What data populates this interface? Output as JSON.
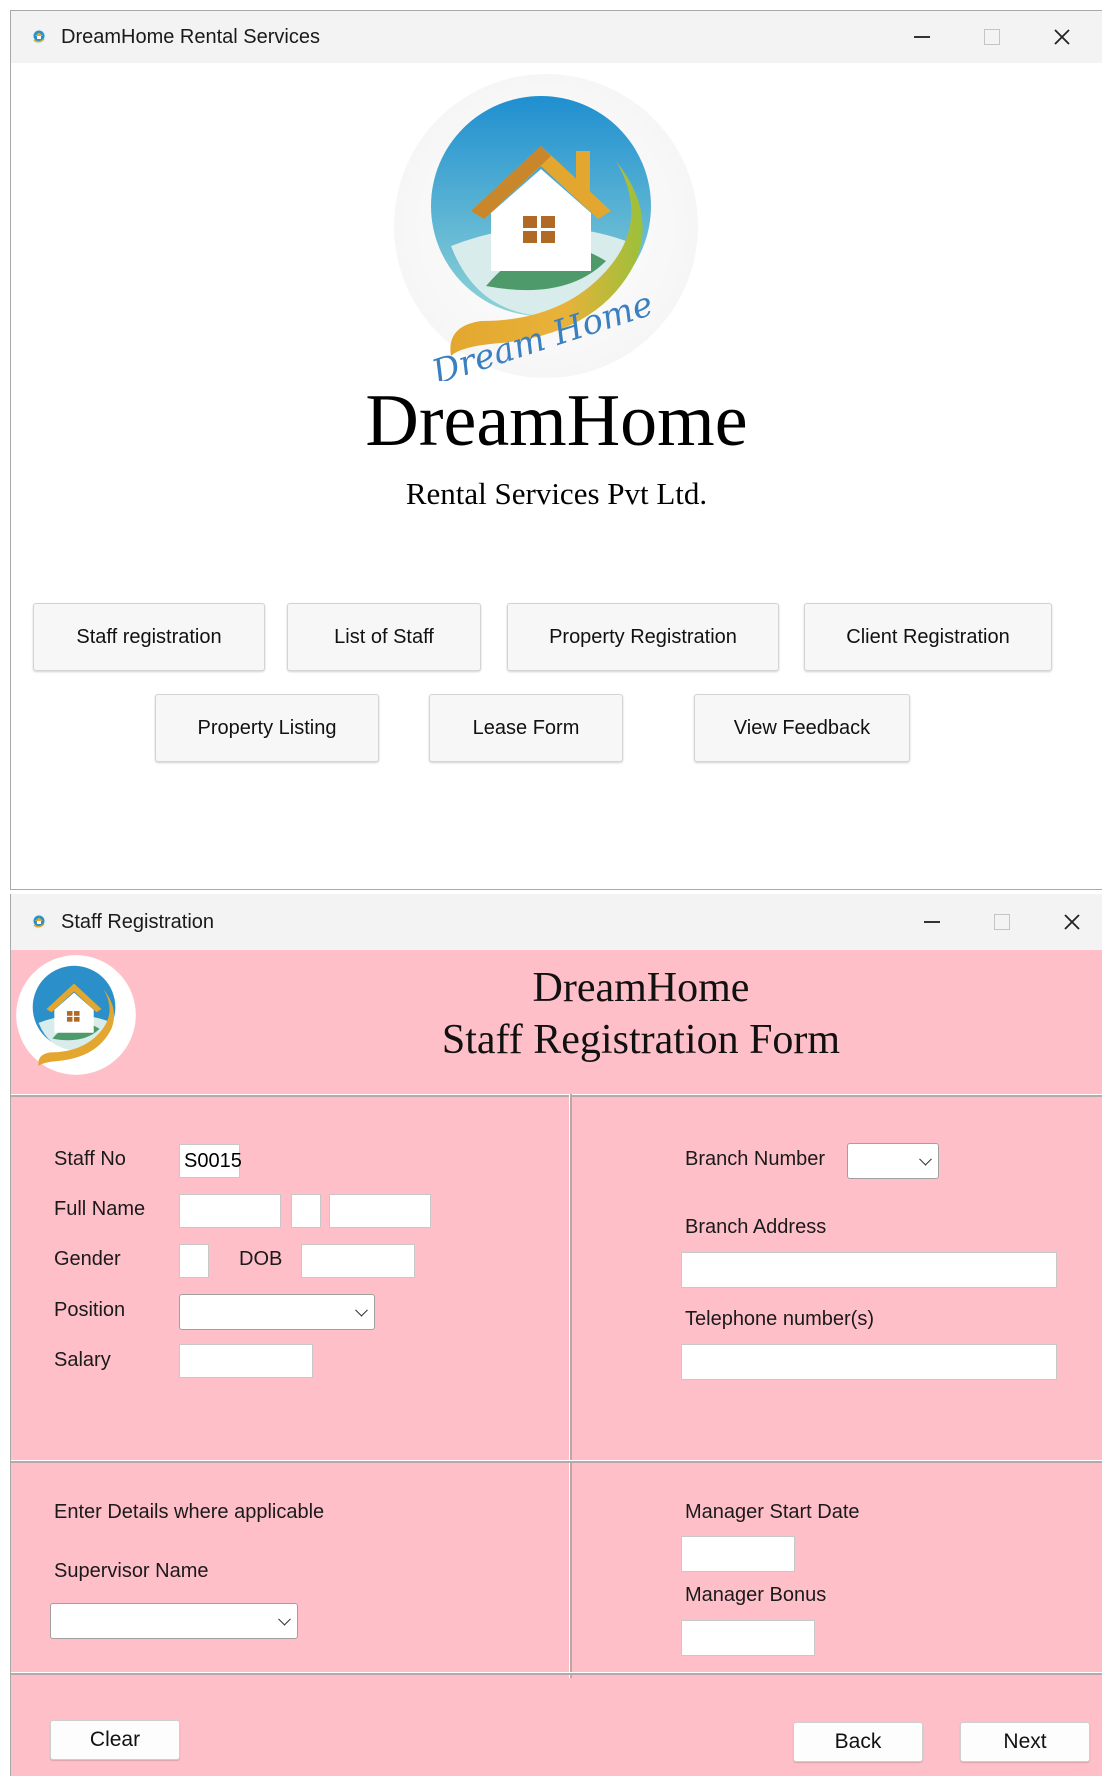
{
  "main_window": {
    "title": "DreamHome Rental Services",
    "brand_name": "DreamHome",
    "tagline": "Rental Services Pvt Ltd.",
    "logo_text": "Dream Home",
    "buttons": [
      "Staff registration",
      "List of Staff",
      "Property Registration",
      "Client Registration",
      "Property Listing",
      "Lease Form",
      "View Feedback"
    ]
  },
  "staff_window": {
    "title": "Staff Registration",
    "heading_line1": "DreamHome",
    "heading_line2": "Staff Registration Form",
    "labels": {
      "staff_no": "Staff No",
      "full_name": "Full Name",
      "gender": "Gender",
      "dob": "DOB",
      "position": "Position",
      "salary": "Salary",
      "branch_number": "Branch Number",
      "branch_address": "Branch Address",
      "telephone": "Telephone number(s)",
      "details_note": "Enter Details where applicable",
      "supervisor_name": "Supervisor Name",
      "manager_start_date": "Manager Start Date",
      "manager_bonus": "Manager Bonus"
    },
    "values": {
      "staff_no": "S0015",
      "first_name": "",
      "middle_initial": "",
      "last_name": "",
      "gender": "",
      "dob": "",
      "position": "",
      "salary": "",
      "branch_number": "",
      "branch_address": "",
      "telephone": "",
      "supervisor_name": "",
      "manager_start_date": "",
      "manager_bonus": ""
    },
    "buttons": {
      "clear": "Clear",
      "back": "Back",
      "next": "Next"
    }
  },
  "icons": {
    "minimize": "minimize-icon",
    "maximize": "maximize-icon",
    "close": "close-icon",
    "dropdown": "chevron-down-icon",
    "app": "dreamhome-logo-icon"
  },
  "colors": {
    "form_background": "#ffbfc9",
    "titlebar": "#f3f3f3",
    "logo_blue": "#2b8fc9",
    "logo_orange": "#e3a72f",
    "logo_green": "#4e9a6a"
  }
}
